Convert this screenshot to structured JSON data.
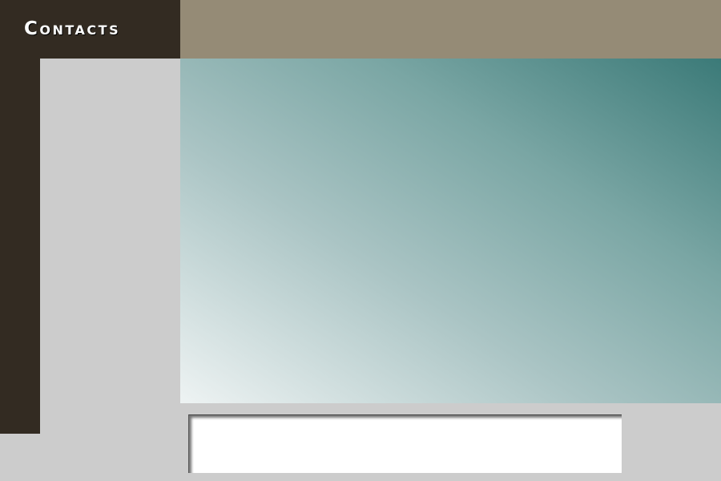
{
  "header": {
    "title": "Contacts"
  },
  "colors": {
    "dark_brown": "#332b22",
    "taupe": "#958b76",
    "page_gray": "#cccccc",
    "teal_dark": "#3b7a78",
    "teal_light": "#eef3f3"
  }
}
